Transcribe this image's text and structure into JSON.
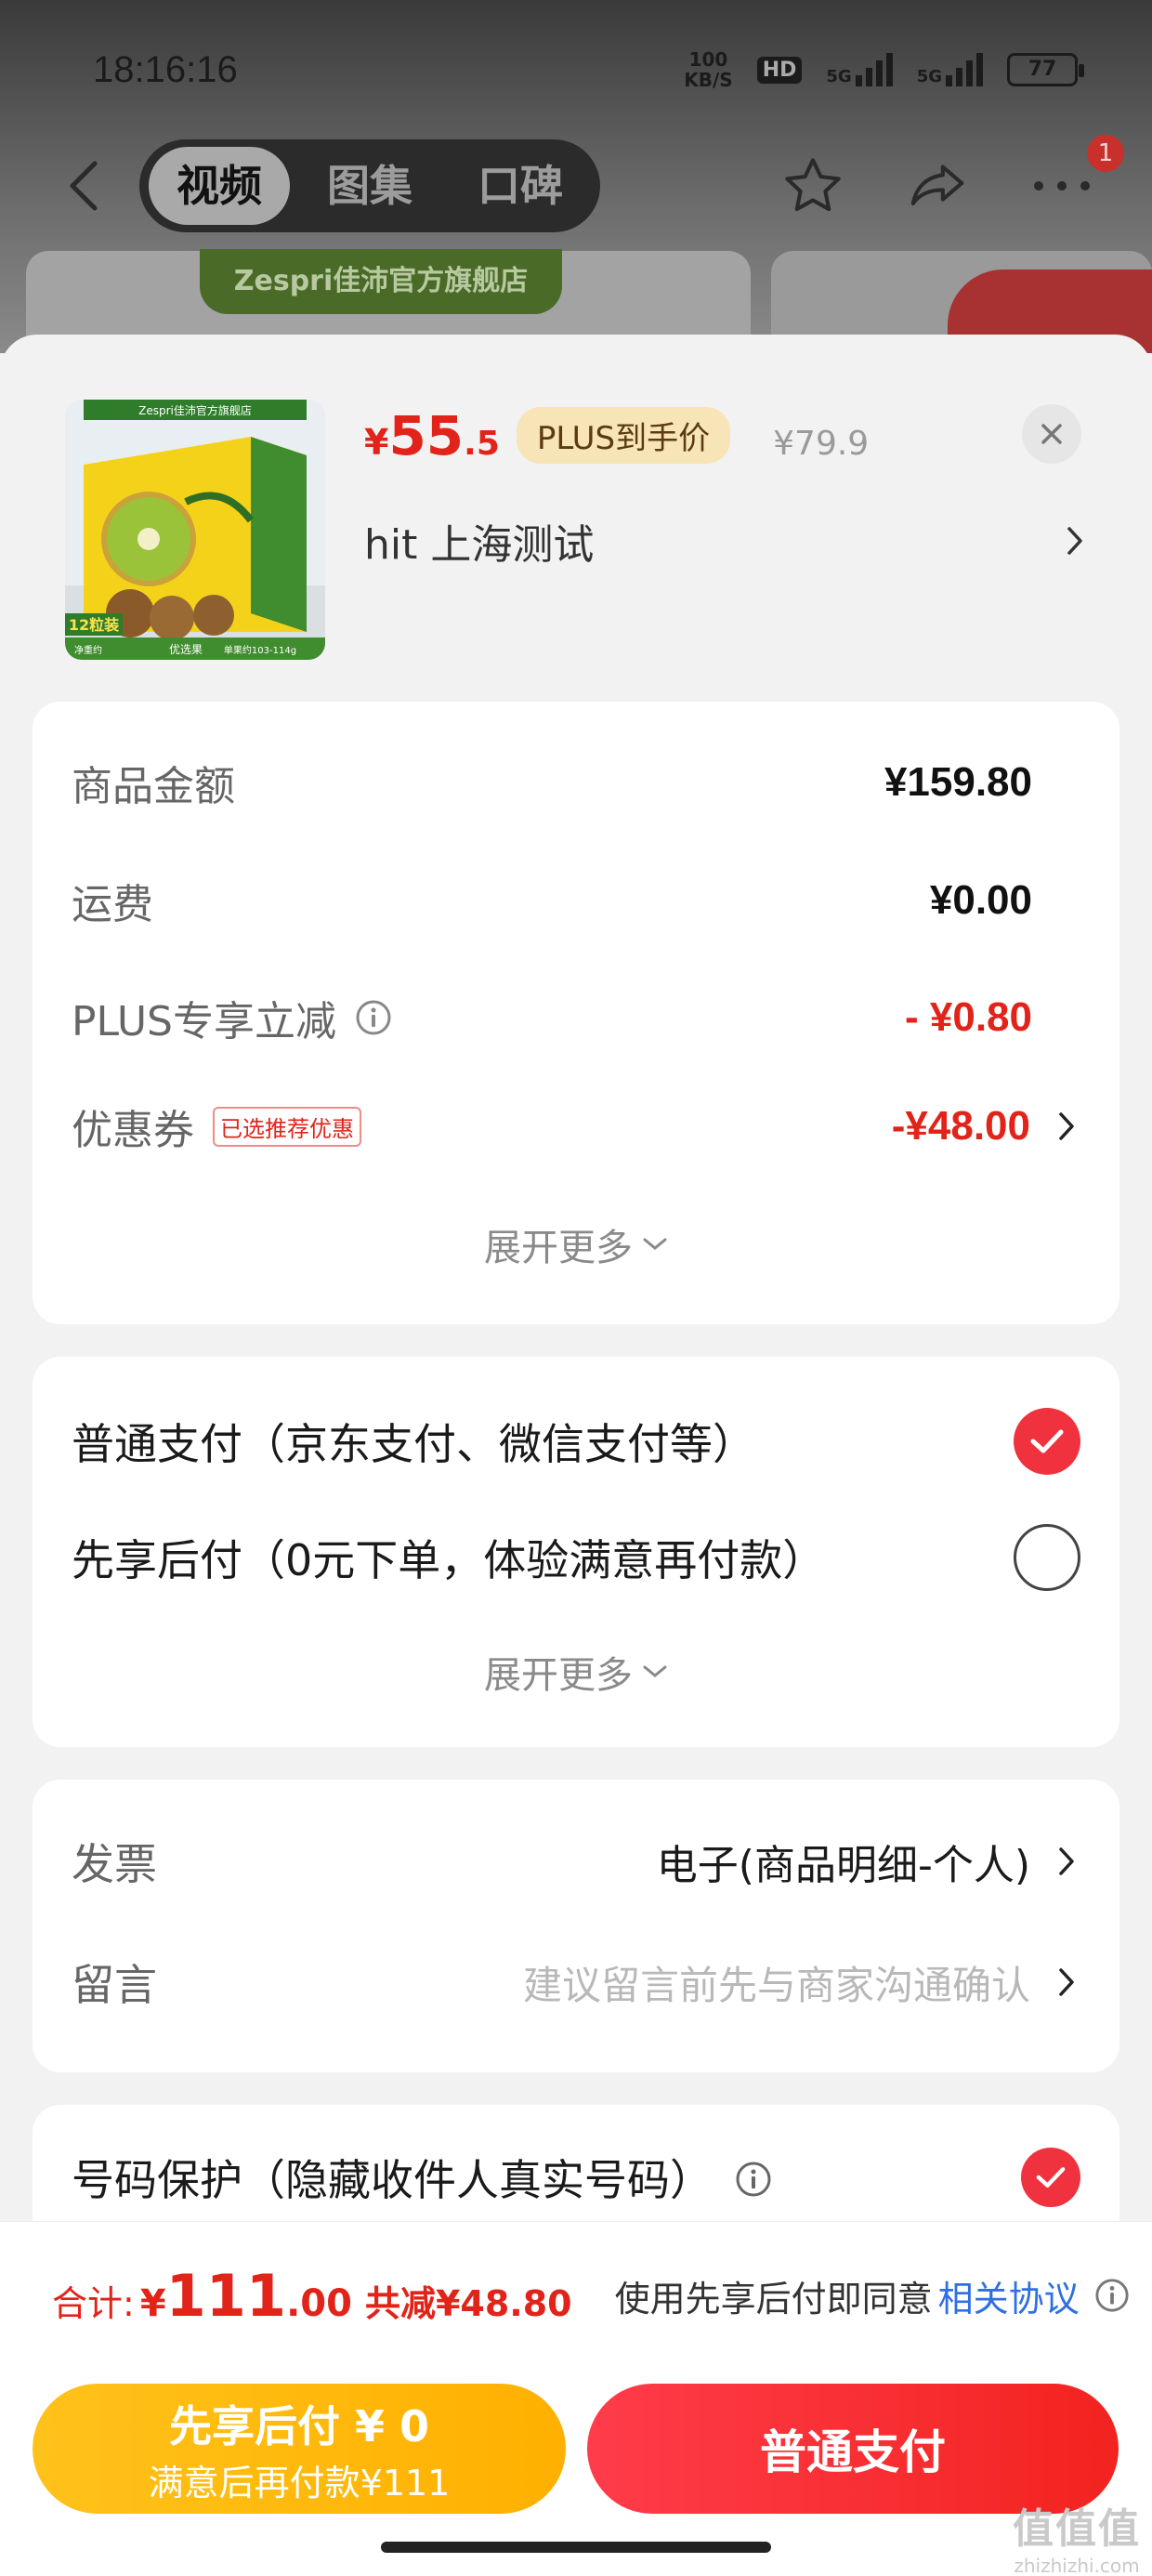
{
  "status": {
    "time": "18:16:16",
    "net_speed_top": "100",
    "net_speed_bottom": "KB/S",
    "hd": "HD",
    "sig1_label": "5G",
    "sig2_label": "5G",
    "battery": "77"
  },
  "header": {
    "tabs": [
      "视频",
      "图集",
      "口碑"
    ],
    "active_tab": "视频",
    "notification_count": "1",
    "store_banner": "Zespri佳沛官方旗舰店"
  },
  "product": {
    "price_currency": "¥",
    "price_int": "55",
    "price_dec": ".5",
    "plus_tag": "PLUS到手价",
    "original_price": "¥79.9",
    "spec": "hit  上海测试",
    "image_labels": {
      "store": "Zespri佳沛官方旗舰店",
      "count": "12粒装",
      "weight": "净重约",
      "grade": "优选果",
      "size": "单果约103-114g"
    }
  },
  "fees": {
    "rows": [
      {
        "label": "商品金额",
        "value": "¥159.80"
      },
      {
        "label": "运费",
        "value": "¥0.00"
      },
      {
        "label": "PLUS专享立减",
        "value": "- ¥0.80"
      },
      {
        "label": "优惠券",
        "value": "-¥48.00"
      }
    ],
    "coupon_tag": "已选推荐优惠",
    "expand": "展开更多"
  },
  "payment": {
    "options": [
      {
        "label": "普通支付（京东支付、微信支付等）",
        "selected": true
      },
      {
        "label": "先享后付（0元下单，体验满意再付款）",
        "selected": false
      }
    ],
    "expand": "展开更多"
  },
  "invoice": {
    "label": "发票",
    "value": "电子(商品明细-个人)",
    "message_label": "留言",
    "message_placeholder": "建议留言前先与商家沟通确认"
  },
  "protection": {
    "label": "号码保护（隐藏收件人真实号码）",
    "checked": true
  },
  "summary": {
    "total_label": "合计:",
    "currency": "¥",
    "total_int": "111",
    "total_dec": ".00",
    "saved": "共减¥48.80",
    "agree_text": "使用先享后付即同意",
    "agree_link": "相关协议"
  },
  "buttons": {
    "later_line1": "先享后付 ¥ 0",
    "later_line2": "满意后再付款¥111",
    "pay": "普通支付"
  },
  "watermark": {
    "logo": "值值值",
    "domain": "zhizhizhi.com"
  },
  "colors": {
    "accent_red": "#e2231a",
    "pay_red": "#f2231f",
    "later_yellow": "#ffb000",
    "link_blue": "#2f6fe4"
  }
}
